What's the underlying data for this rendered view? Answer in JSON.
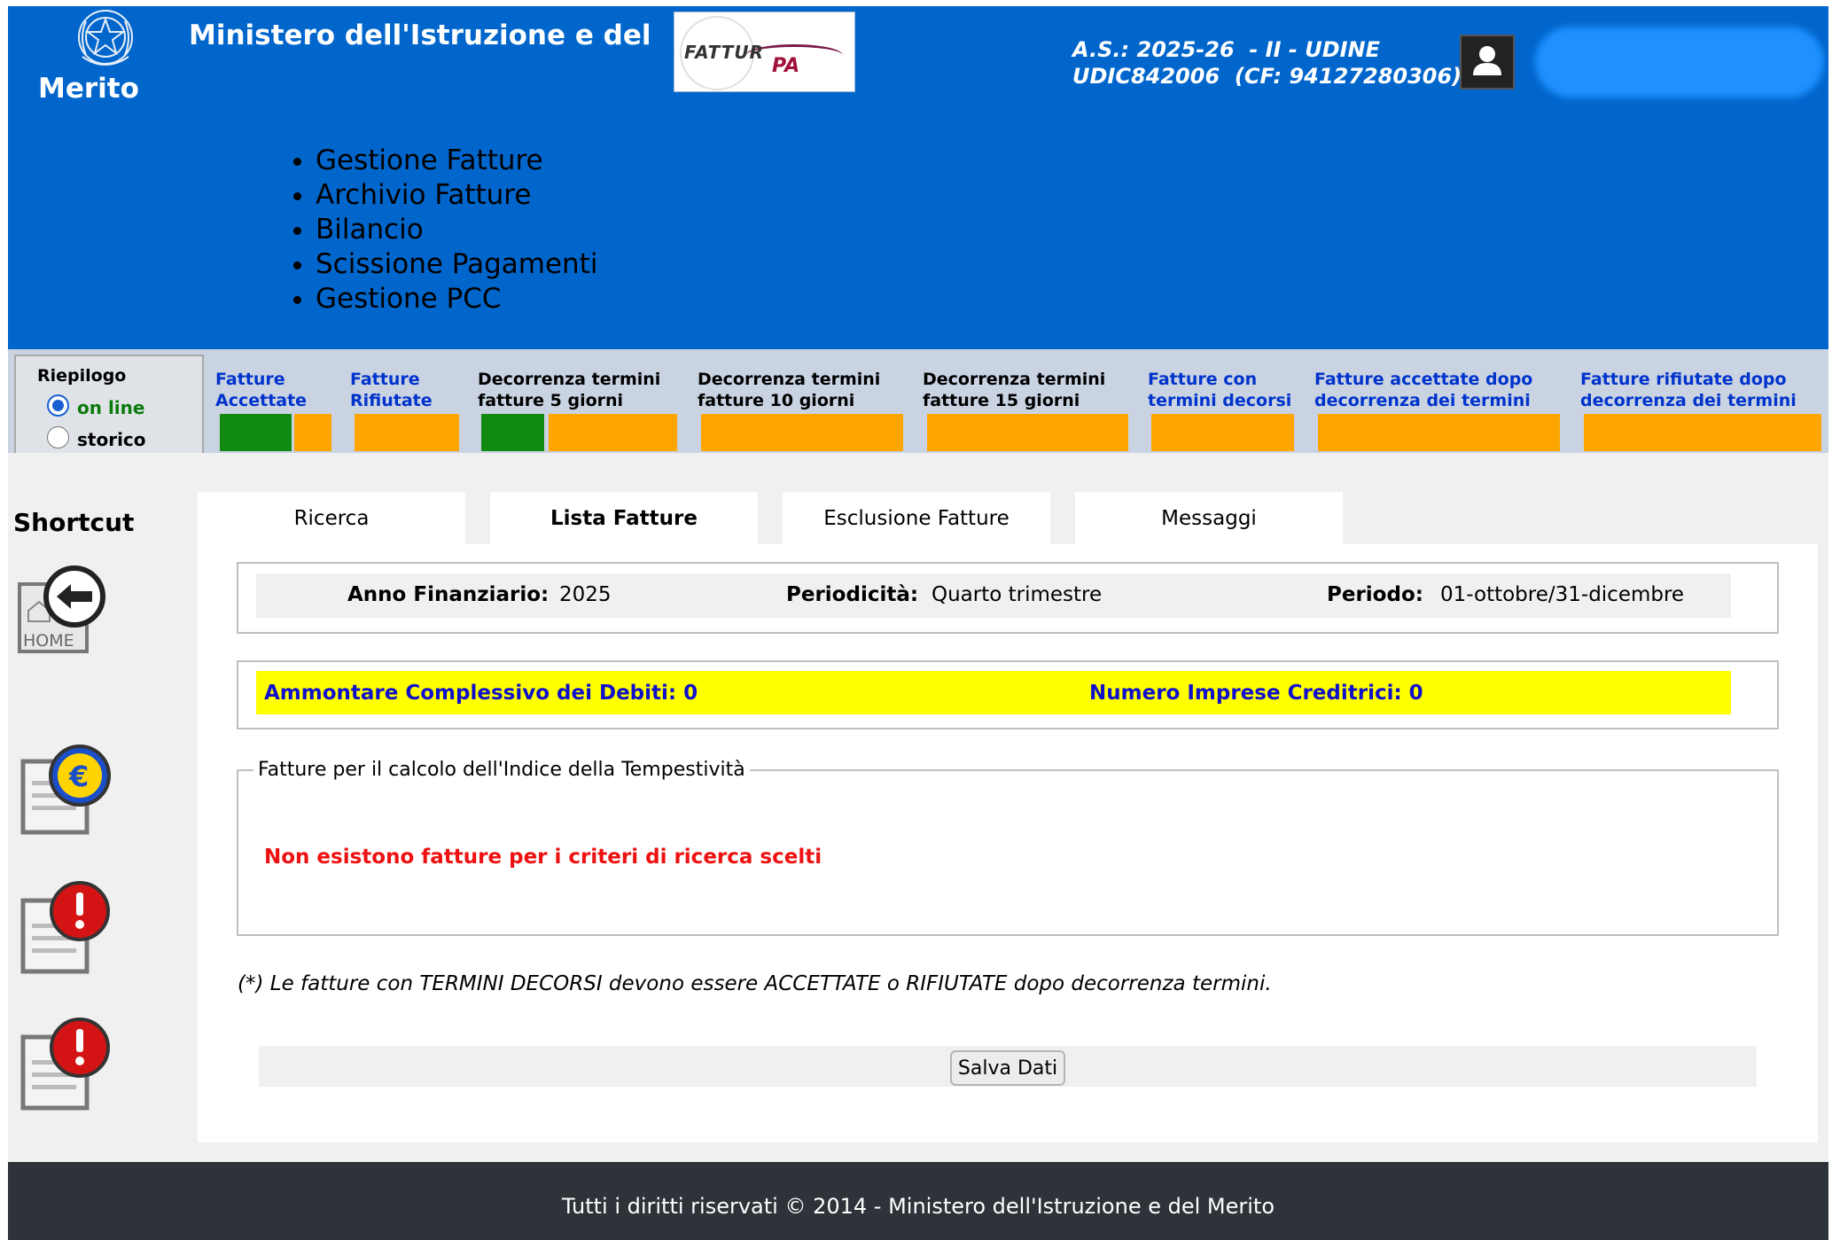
{
  "header": {
    "ministry_line1": "Ministero dell'Istruzione e del",
    "ministry_line2": "Merito",
    "logo_text_left": "FATTUR",
    "logo_text_right": "PA",
    "school_line1": "A.S.: 2025-26  - II - UDINE",
    "school_line2": "UDIC842006  (CF: 94127280306)"
  },
  "menu": {
    "items": [
      "Gestione Fatture",
      "Archivio Fatture",
      "Bilancio",
      "Scissione Pagamenti",
      "Gestione PCC"
    ]
  },
  "riepilogo": {
    "title": "Riepilogo",
    "online_label": "on line",
    "storico_label": "storico",
    "selected": "on line"
  },
  "status": [
    {
      "label": "Fatture\nAccettate",
      "link": true
    },
    {
      "label": "Fatture\nRifiutate",
      "link": true
    },
    {
      "label": "Decorrenza termini\nfatture 5 giorni",
      "link": false
    },
    {
      "label": "Decorrenza termini\nfatture 10 giorni",
      "link": false
    },
    {
      "label": "Decorrenza termini\nfatture 15 giorni",
      "link": false
    },
    {
      "label": "Fatture con\ntermini decorsi",
      "link": true
    },
    {
      "label": "Fatture accettate dopo\ndecorrenza dei termini",
      "link": true
    },
    {
      "label": "Fatture rifiutate dopo\ndecorrenza dei termini",
      "link": true
    }
  ],
  "colors": {
    "header_blue": "#0066cc",
    "bar_green": "#118a11",
    "bar_orange": "#ffa500",
    "alert_yellow": "#ffff00",
    "link_blue": "#0033cc",
    "error_red": "#ee1111",
    "footer_dark": "#2e3339"
  },
  "sidebar": {
    "title": "Shortcut",
    "home_label": "HOME"
  },
  "tabs": [
    {
      "label": "Ricerca",
      "active": false
    },
    {
      "label": "Lista Fatture",
      "active": true
    },
    {
      "label": "Esclusione Fatture",
      "active": false
    },
    {
      "label": "Messaggi",
      "active": false
    }
  ],
  "filter": {
    "anno_label": "Anno Finanziario:",
    "anno_value": "2025",
    "periodicita_label": "Periodicità:",
    "periodicita_value": "Quarto trimestre",
    "periodo_label": "Periodo:",
    "periodo_value": "01-ottobre/31-dicembre"
  },
  "summary": {
    "debiti": "Ammontare Complessivo dei Debiti: 0",
    "imprese": "Numero Imprese Creditrici: 0"
  },
  "fieldset": {
    "legend": "Fatture per il calcolo dell'Indice della Tempestività",
    "empty_message": "Non esistono fatture per i criteri di ricerca scelti"
  },
  "note": "(*) Le fatture con TERMINI DECORSI devono essere ACCETTATE o RIFIUTATE dopo decorrenza termini.",
  "save_button": "Salva Dati",
  "footer": "Tutti i diritti riservati © 2014 -  Ministero dell'Istruzione e del Merito"
}
